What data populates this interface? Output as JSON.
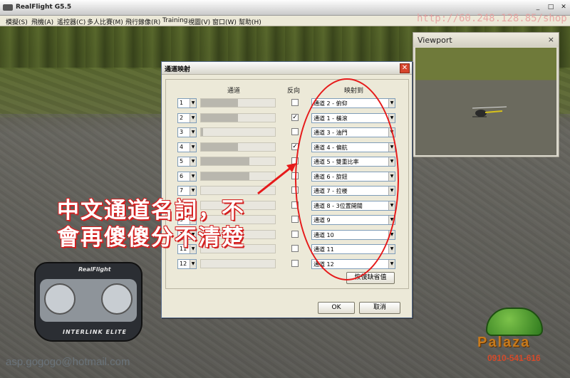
{
  "window": {
    "title": "RealFlight G5.5"
  },
  "menu": [
    {
      "label": "模擬(S)"
    },
    {
      "label": "飛機(A)"
    },
    {
      "label": "遙控器(C)"
    },
    {
      "label": "多人比賽(M)"
    },
    {
      "label": "飛行錄像(R)"
    },
    {
      "label": "Training"
    },
    {
      "label": "視圖(V)"
    },
    {
      "label": "窗口(W)"
    },
    {
      "label": "幫助(H)"
    }
  ],
  "watermarks": {
    "url": "http://60.248.128.85/shop",
    "email": "asp.gogogo@hotmail.com"
  },
  "viewport": {
    "title": "Viewport",
    "close": "×"
  },
  "dialog": {
    "title": "通道映射",
    "close": "✕",
    "headers": {
      "channel": "通道",
      "reverse": "反向",
      "mapping": "映射到"
    },
    "rows": [
      {
        "channel": "1",
        "level": 0.5,
        "reversed": false,
        "mapping": "通道 2 - 俯仰"
      },
      {
        "channel": "2",
        "level": 0.5,
        "reversed": true,
        "mapping": "通道 1 - 橫滾"
      },
      {
        "channel": "3",
        "level": 0.03,
        "reversed": false,
        "mapping": "通道 3 - 油門"
      },
      {
        "channel": "4",
        "level": 0.5,
        "reversed": true,
        "mapping": "通道 4 - 偏航"
      },
      {
        "channel": "5",
        "level": 0.65,
        "reversed": false,
        "mapping": "通道 5 - 雙重比率"
      },
      {
        "channel": "6",
        "level": 0.65,
        "reversed": false,
        "mapping": "通道 6 - 旋鈕"
      },
      {
        "channel": "7",
        "level": 0.0,
        "reversed": false,
        "mapping": "通道 7 - 拉楼"
      },
      {
        "channel": "8",
        "level": 0.0,
        "reversed": false,
        "mapping": "通道 8 - 3位置開關"
      },
      {
        "channel": "9",
        "level": 0.0,
        "reversed": false,
        "mapping": "通道 9"
      },
      {
        "channel": "10",
        "level": 0.0,
        "reversed": false,
        "mapping": "通道 10"
      },
      {
        "channel": "11",
        "level": 0.0,
        "reversed": false,
        "mapping": "通道 11"
      },
      {
        "channel": "12",
        "level": 0.0,
        "reversed": false,
        "mapping": "通道 12"
      }
    ],
    "check_mark": "✓",
    "dropdown_arrow": "▼",
    "restore_label": "恢復缺省值",
    "ok_label": "OK",
    "cancel_label": "取消"
  },
  "annotation": {
    "line1": "中文通道名詞，不",
    "line2": "會再傻傻分不清楚",
    "color": "#e61a1a"
  },
  "controller": {
    "brand": "RealFlight",
    "model": "INTERLINK ELITE"
  },
  "logo": {
    "name": "Palaza",
    "phone": "0910-541-616"
  }
}
